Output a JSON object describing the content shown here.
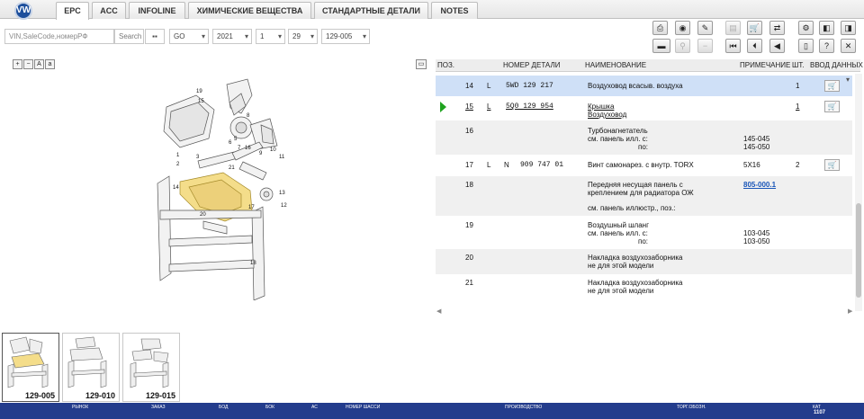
{
  "brand": {
    "logo_text": "VW",
    "accent": "#1d4f9c",
    "status_bar_color": "#233c8c"
  },
  "tabs": [
    {
      "label": "EPC"
    },
    {
      "label": "ACC"
    },
    {
      "label": "INFOLINE"
    },
    {
      "label": "ХИМИЧЕСКИЕ ВЕЩЕСТВА"
    },
    {
      "label": "СТАНДАРТНЫЕ ДЕТАЛИ"
    },
    {
      "label": "NOTES"
    }
  ],
  "search": {
    "placeholder": "VIN,SaleCode,номерРФ",
    "button": "Search",
    "model": "GO",
    "year": "2021",
    "group": "1",
    "subgroup": "29",
    "illustration": "129-005"
  },
  "table": {
    "headers": [
      "ПОЗ.",
      "НОМЕР ДЕТАЛИ",
      "НАИМЕНОВАНИЕ",
      "ПРИМЕЧАНИЕ",
      "ШТ.",
      "ВВОД ДАННЫХ"
    ],
    "rows": [
      {
        "pos": "14",
        "l": "L",
        "n": "",
        "part": "5WD 129 217",
        "name": [
          "Воздуховод всасыв. воздуха"
        ],
        "note": [
          ""
        ],
        "qty": "1"
      },
      {
        "pos": "15",
        "l": "L",
        "n": "",
        "part": "5Q0 129 954",
        "name": [
          "Крышка",
          "Воздуховод"
        ],
        "note": [
          ""
        ],
        "qty": "1"
      },
      {
        "pos": "16",
        "l": "",
        "n": "",
        "part": "",
        "name": [
          "Турбонагнетатель",
          "см. панель илл. с:",
          "по:"
        ],
        "note": [
          "",
          "145-045",
          "145-050"
        ],
        "qty": ""
      },
      {
        "pos": "17",
        "l": "L",
        "n": "N",
        "part": "909 747 01",
        "name": [
          "Винт самонарез. с внутр. TORX"
        ],
        "note": [
          "5X16"
        ],
        "qty": "2"
      },
      {
        "pos": "18",
        "l": "",
        "n": "",
        "part": "",
        "name": [
          "Передняя несущая панель с",
          "креплением для радиатора ОЖ",
          "",
          "см. панель иллюстр., поз.:"
        ],
        "note": [
          "805-000.1"
        ],
        "qty": ""
      },
      {
        "pos": "19",
        "l": "",
        "n": "",
        "part": "",
        "name": [
          "Воздушный шланг",
          "см. панель илл. с:",
          "по:"
        ],
        "note": [
          "",
          "103-045",
          "103-050"
        ],
        "qty": ""
      },
      {
        "pos": "20",
        "l": "",
        "n": "",
        "part": "",
        "name": [
          "Накладка воздухозаборника",
          "не для этой модели"
        ],
        "note": [
          ""
        ],
        "qty": ""
      },
      {
        "pos": "21",
        "l": "",
        "n": "",
        "part": "",
        "name": [
          "Накладка воздухозаборника",
          "не для этой модели"
        ],
        "note": [
          ""
        ],
        "qty": ""
      }
    ]
  },
  "diagram": {
    "callouts": [
      "19",
      "15",
      "14",
      "6",
      "7",
      "8",
      "9",
      "10",
      "11",
      "12",
      "13",
      "16",
      "17",
      "18",
      "20",
      "21",
      "3",
      "2",
      "1",
      "5"
    ]
  },
  "thumbnails": [
    {
      "label": "129-005"
    },
    {
      "label": "129-010"
    },
    {
      "label": "129-015"
    }
  ],
  "status_bar": {
    "labels": [
      "РЫНОК",
      "ЗАКАЗ",
      "БОД",
      "БОК",
      "АС",
      "НОМЕР ШАССИ",
      "ПРОИЗВОДСТВО",
      "ТОРГ.ОБОЗН.",
      "КАТ"
    ],
    "kat_value": "1107"
  },
  "icons": [
    "printer-icon",
    "settings-icon",
    "cart-icon",
    "first-icon",
    "prev-icon",
    "help-icon",
    "close-icon",
    "zoom-in-icon",
    "zoom-out-icon"
  ]
}
